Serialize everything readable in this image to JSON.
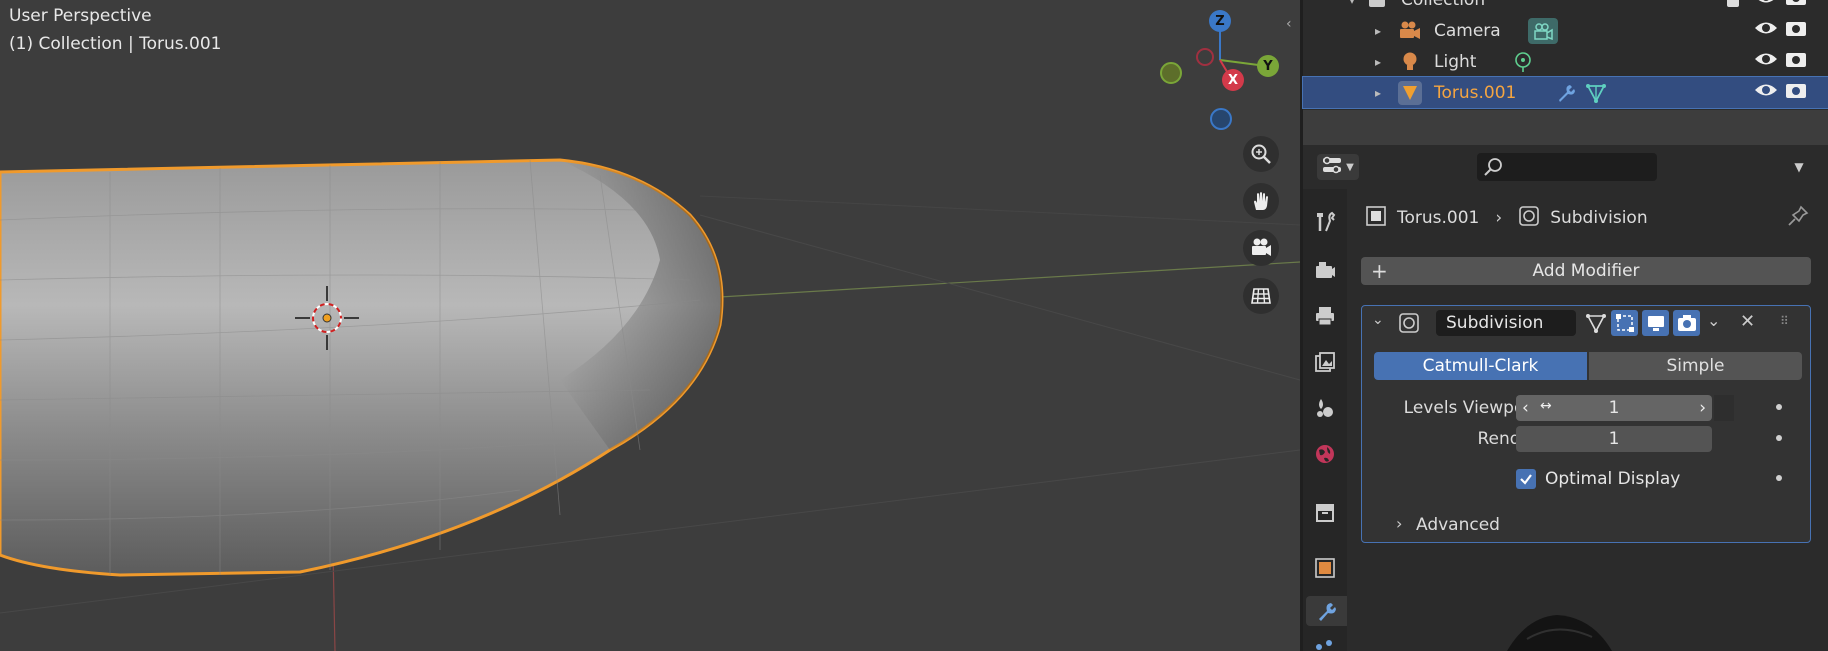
{
  "viewport": {
    "view_name": "User Perspective",
    "context_label": "(1) Collection | Torus.001",
    "gizmo": {
      "x": "X",
      "y": "Y",
      "z": "Z"
    },
    "nav_icons": [
      "zoom-icon",
      "hand-pan-icon",
      "camera-view-icon",
      "grid-ortho-icon"
    ],
    "selection_color": "#f0a030"
  },
  "outliner": {
    "collection_label": "Collection",
    "items": [
      {
        "label": "Camera",
        "icon": "camera-object-icon",
        "extra": "camera-data-icon"
      },
      {
        "label": "Light",
        "icon": "light-object-icon",
        "extra": "light-data-icon"
      },
      {
        "label": "Torus.001",
        "icon": "mesh-object-icon",
        "extra": "modifier-wrench-icon",
        "extra2": "mesh-data-icon",
        "selected": true
      }
    ]
  },
  "properties": {
    "breadcrumb": {
      "object": "Torus.001",
      "modifier": "Subdivision"
    },
    "add_modifier_label": "Add Modifier",
    "modifier": {
      "name": "Subdivision",
      "mode_options": [
        "Catmull-Clark",
        "Simple"
      ],
      "mode_selected": "Catmull-Clark",
      "levels_viewport_label": "Levels Viewport",
      "levels_viewport_value": "1",
      "render_label": "Render",
      "render_value": "1",
      "optimal_display_label": "Optimal Display",
      "optimal_display_checked": true,
      "advanced_label": "Advanced"
    }
  },
  "colors": {
    "accent": "#4772b3",
    "active_outline": "#f0a030"
  }
}
